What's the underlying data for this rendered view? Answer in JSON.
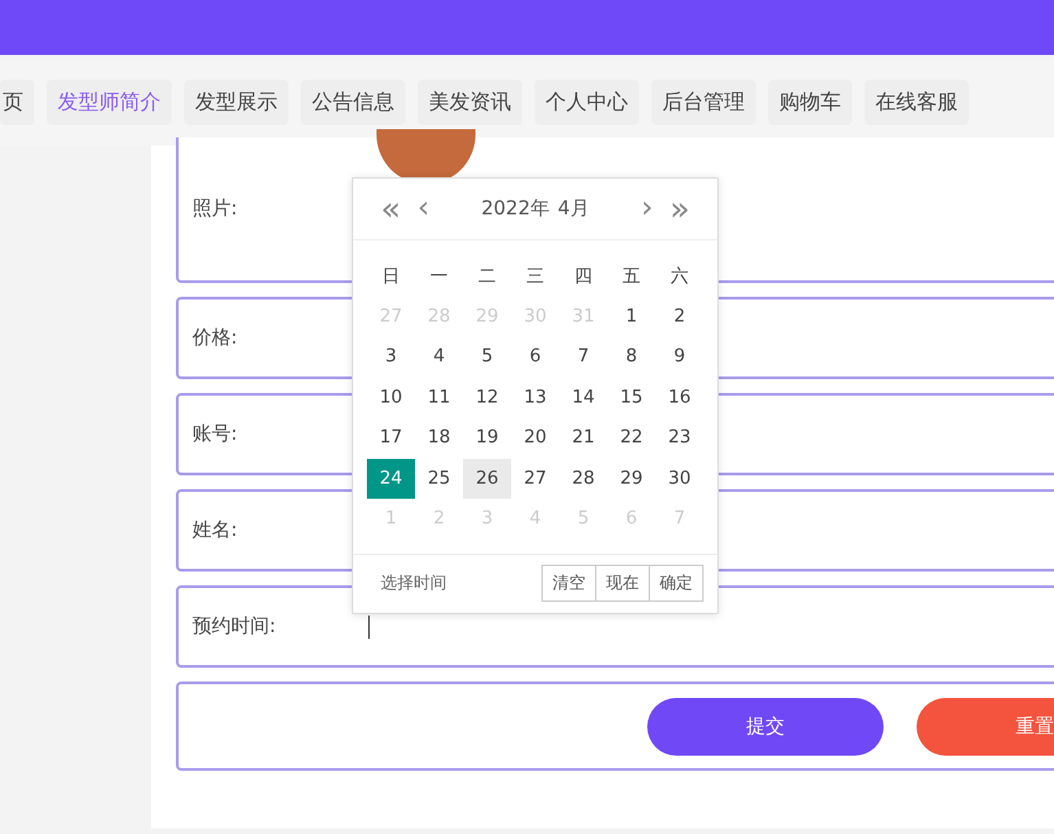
{
  "nav": [
    {
      "label": "页",
      "selected": false
    },
    {
      "label": "发型师简介",
      "selected": true
    },
    {
      "label": "发型展示",
      "selected": false
    },
    {
      "label": "公告信息",
      "selected": false
    },
    {
      "label": "美发资讯",
      "selected": false
    },
    {
      "label": "个人中心",
      "selected": false
    },
    {
      "label": "后台管理",
      "selected": false
    },
    {
      "label": "购物车",
      "selected": false
    },
    {
      "label": "在线客服",
      "selected": false
    }
  ],
  "form": {
    "fields": [
      {
        "kind": "photo",
        "label": "照片:"
      },
      {
        "kind": "text",
        "label": "价格:"
      },
      {
        "kind": "text",
        "label": "账号:"
      },
      {
        "kind": "text",
        "label": "姓名:"
      },
      {
        "kind": "datetime",
        "label": "预约时间:",
        "focused": true
      }
    ],
    "buttons": [
      {
        "kind": "submit",
        "label": "提交"
      },
      {
        "kind": "reset",
        "label": "重置"
      }
    ]
  },
  "date_picker": {
    "prev_year": "«",
    "prev_month": "‹",
    "year": "2022年",
    "month": "4月",
    "next_month": "›",
    "next_year": "»",
    "weekdays": [
      "日",
      "一",
      "二",
      "三",
      "四",
      "五",
      "六"
    ],
    "weeks": [
      [
        {
          "day": "27",
          "outside": true,
          "selected": false,
          "hovered": false
        },
        {
          "day": "28",
          "outside": true,
          "selected": false,
          "hovered": false
        },
        {
          "day": "29",
          "outside": true,
          "selected": false,
          "hovered": false
        },
        {
          "day": "30",
          "outside": true,
          "selected": false,
          "hovered": false
        },
        {
          "day": "31",
          "outside": true,
          "selected": false,
          "hovered": false
        },
        {
          "day": "1",
          "outside": false,
          "selected": false,
          "hovered": false
        },
        {
          "day": "2",
          "outside": false,
          "selected": false,
          "hovered": false
        }
      ],
      [
        {
          "day": "3",
          "outside": false,
          "selected": false,
          "hovered": false
        },
        {
          "day": "4",
          "outside": false,
          "selected": false,
          "hovered": false
        },
        {
          "day": "5",
          "outside": false,
          "selected": false,
          "hovered": false
        },
        {
          "day": "6",
          "outside": false,
          "selected": false,
          "hovered": false
        },
        {
          "day": "7",
          "outside": false,
          "selected": false,
          "hovered": false
        },
        {
          "day": "8",
          "outside": false,
          "selected": false,
          "hovered": false
        },
        {
          "day": "9",
          "outside": false,
          "selected": false,
          "hovered": false
        }
      ],
      [
        {
          "day": "10",
          "outside": false,
          "selected": false,
          "hovered": false
        },
        {
          "day": "11",
          "outside": false,
          "selected": false,
          "hovered": false
        },
        {
          "day": "12",
          "outside": false,
          "selected": false,
          "hovered": false
        },
        {
          "day": "13",
          "outside": false,
          "selected": false,
          "hovered": false
        },
        {
          "day": "14",
          "outside": false,
          "selected": false,
          "hovered": false
        },
        {
          "day": "15",
          "outside": false,
          "selected": false,
          "hovered": false
        },
        {
          "day": "16",
          "outside": false,
          "selected": false,
          "hovered": false
        }
      ],
      [
        {
          "day": "17",
          "outside": false,
          "selected": false,
          "hovered": false
        },
        {
          "day": "18",
          "outside": false,
          "selected": false,
          "hovered": false
        },
        {
          "day": "19",
          "outside": false,
          "selected": false,
          "hovered": false
        },
        {
          "day": "20",
          "outside": false,
          "selected": false,
          "hovered": false
        },
        {
          "day": "21",
          "outside": false,
          "selected": false,
          "hovered": false
        },
        {
          "day": "22",
          "outside": false,
          "selected": false,
          "hovered": false
        },
        {
          "day": "23",
          "outside": false,
          "selected": false,
          "hovered": false
        }
      ],
      [
        {
          "day": "24",
          "outside": false,
          "selected": true,
          "hovered": false
        },
        {
          "day": "25",
          "outside": false,
          "selected": false,
          "hovered": false
        },
        {
          "day": "26",
          "outside": false,
          "selected": false,
          "hovered": true
        },
        {
          "day": "27",
          "outside": false,
          "selected": false,
          "hovered": false
        },
        {
          "day": "28",
          "outside": false,
          "selected": false,
          "hovered": false
        },
        {
          "day": "29",
          "outside": false,
          "selected": false,
          "hovered": false
        },
        {
          "day": "30",
          "outside": false,
          "selected": false,
          "hovered": false
        }
      ],
      [
        {
          "day": "1",
          "outside": true,
          "selected": false,
          "hovered": false
        },
        {
          "day": "2",
          "outside": true,
          "selected": false,
          "hovered": false
        },
        {
          "day": "3",
          "outside": true,
          "selected": false,
          "hovered": false
        },
        {
          "day": "4",
          "outside": true,
          "selected": false,
          "hovered": false
        },
        {
          "day": "5",
          "outside": true,
          "selected": false,
          "hovered": false
        },
        {
          "day": "6",
          "outside": true,
          "selected": false,
          "hovered": false
        },
        {
          "day": "7",
          "outside": true,
          "selected": false,
          "hovered": false
        }
      ]
    ],
    "time_link": "选择时间",
    "buttons": [
      "清空",
      "现在",
      "确定"
    ]
  }
}
